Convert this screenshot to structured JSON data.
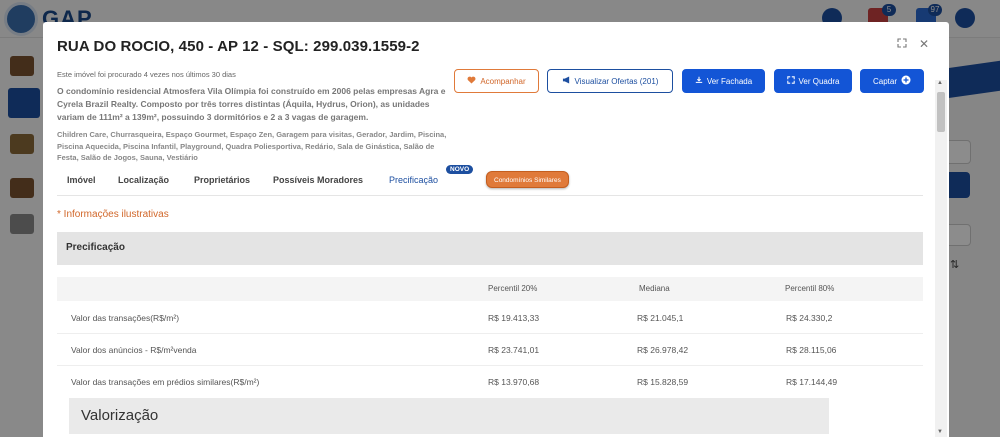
{
  "background": {
    "logo_text": "GAP",
    "badges": [
      "5",
      "97"
    ]
  },
  "modal": {
    "title": "RUA DO ROCIO, 450 - AP 12 - SQL: 299.039.1559-2",
    "search_note": "Este imóvel foi procurado 4 vezes nos últimos 30 dias",
    "description": "O condomínio residencial Atmosfera Vila Olímpia foi construído em 2006 pelas empresas Agra e Cyrela Brazil Realty. Composto por três torres distintas (Áquila, Hydrus, Orion), as unidades variam de 111m² a 139m², possuindo 3 dormitórios e 2 a 3 vagas de garagem.",
    "amenities": "Children Care, Churrasqueira, Espaço Gourmet, Espaço Zen, Garagem para visitas, Gerador, Jardim, Piscina, Piscina Aquecida, Piscina Infantil, Playground, Quadra Poliesportiva, Redário, Sala de Ginástica, Salão de Festa, Salão de Jogos, Sauna, Vestiário"
  },
  "actions": {
    "acompanhar": "Acompanhar",
    "ofertas": "Visualizar Ofertas (201)",
    "fachada": "Ver Fachada",
    "quadra": "Ver Quadra",
    "captar": "Captar"
  },
  "tabs": {
    "imovel": "Imóvel",
    "localizacao": "Localização",
    "proprietarios": "Proprietários",
    "moradores": "Possíveis Moradores",
    "precificacao": "Precificação",
    "novo_badge": "NOVO",
    "similares": "Condomínios Similares"
  },
  "content": {
    "note": "* Informações ilustrativas",
    "section_title": "Precificação",
    "table": {
      "headers": [
        "Percentil 20%",
        "Mediana",
        "Percentil 80%"
      ],
      "rows": [
        {
          "label": "Valor das transações(R$/m²)",
          "p20": "R$ 19.413,33",
          "median": "R$ 21.045,1",
          "p80": "R$ 24.330,2"
        },
        {
          "label": "Valor dos anúncios - R$/m²venda",
          "p20": "R$ 23.741,01",
          "median": "R$ 26.978,42",
          "p80": "R$ 28.115,06"
        },
        {
          "label": "Valor das transações em prédios similares(R$/m²)",
          "p20": "R$ 13.970,68",
          "median": "R$ 15.828,59",
          "p80": "R$ 17.144,49"
        }
      ]
    },
    "valorizacao_title": "Valorização"
  },
  "colors": {
    "primary": "#1355d6",
    "accent_orange": "#e07a3a",
    "dark_blue": "#1d4fa0"
  }
}
